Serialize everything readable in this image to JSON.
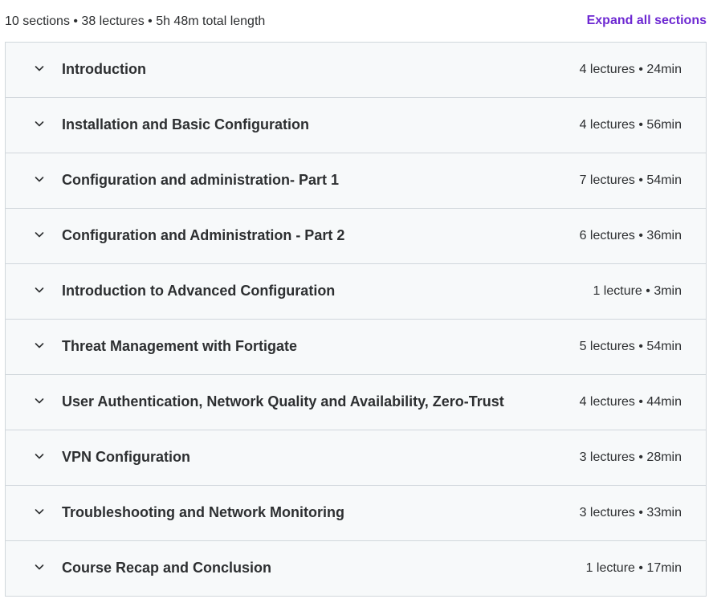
{
  "header": {
    "summary": "10 sections • 38 lectures • 5h 48m total length",
    "expand_all_label": "Expand all sections"
  },
  "colors": {
    "accent": "#6d28d2",
    "text": "#2d2f31",
    "row_bg": "#f7f9fa",
    "border": "#d1d7dc"
  },
  "sections": [
    {
      "title": "Introduction",
      "meta": "4 lectures • 24min",
      "icon": "chevron-down-icon"
    },
    {
      "title": "Installation and Basic Configuration",
      "meta": "4 lectures • 56min",
      "icon": "chevron-down-icon"
    },
    {
      "title": "Configuration and administration- Part 1",
      "meta": "7 lectures • 54min",
      "icon": "chevron-down-icon"
    },
    {
      "title": "Configuration and Administration - Part 2",
      "meta": "6 lectures • 36min",
      "icon": "chevron-down-icon"
    },
    {
      "title": "Introduction to Advanced Configuration",
      "meta": "1 lecture • 3min",
      "icon": "chevron-down-icon"
    },
    {
      "title": "Threat Management with Fortigate",
      "meta": "5 lectures • 54min",
      "icon": "chevron-down-icon"
    },
    {
      "title": "User Authentication, Network Quality and Availability, Zero-Trust",
      "meta": "4 lectures • 44min",
      "icon": "chevron-down-icon"
    },
    {
      "title": "VPN Configuration",
      "meta": "3 lectures • 28min",
      "icon": "chevron-down-icon"
    },
    {
      "title": "Troubleshooting and Network Monitoring",
      "meta": "3 lectures • 33min",
      "icon": "chevron-down-icon"
    },
    {
      "title": "Course Recap and Conclusion",
      "meta": "1 lecture • 17min",
      "icon": "chevron-down-icon"
    }
  ]
}
